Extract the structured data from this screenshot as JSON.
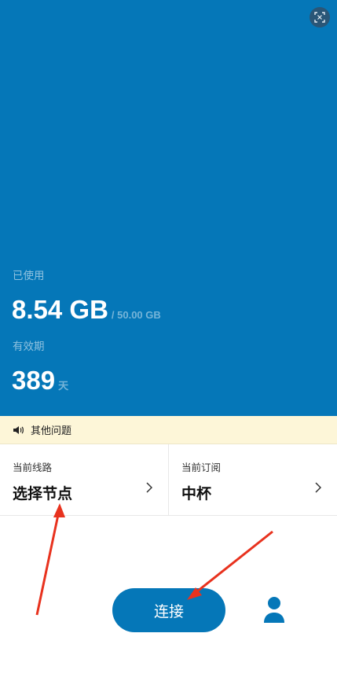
{
  "usage": {
    "used_label": "已使用",
    "used_value": "8.54 GB",
    "used_total": "/ 50.00 GB",
    "validity_label": "有效期",
    "validity_value": "389",
    "validity_unit": "天"
  },
  "notice": {
    "text": "其他问题",
    "icon": "speaker-icon"
  },
  "route": {
    "title": "当前线路",
    "value": "选择节点"
  },
  "subscription": {
    "title": "当前订阅",
    "value": "中杯"
  },
  "actions": {
    "connect_label": "连接"
  },
  "colors": {
    "primary": "#0577b8",
    "notice_bg": "#fdf6d8",
    "annotation": "#e8321e"
  }
}
